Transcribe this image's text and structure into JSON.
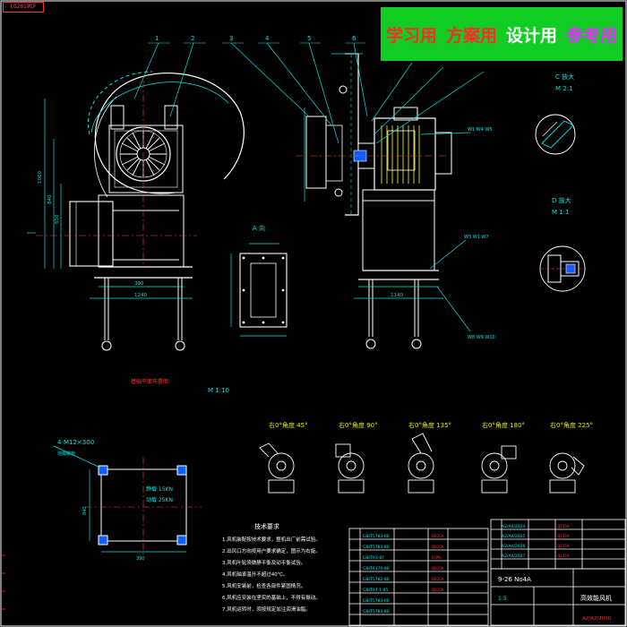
{
  "drawing": {
    "corner_code": "CG2019CF",
    "banner": {
      "items": [
        {
          "label": "学习用",
          "color": "#ff2a2a"
        },
        {
          "label": "方案用",
          "color": "#ff2a2a"
        },
        {
          "label": "设计用",
          "color": "#ffffff"
        },
        {
          "label": "参考用",
          "color": "#e033ff"
        }
      ]
    },
    "part_callouts": [
      "1",
      "2",
      "3",
      "4",
      "5",
      "6"
    ],
    "view_labels": {
      "section_a": "A 向",
      "detail_c": "C 放大",
      "detail_c_scale": "M 2:1",
      "detail_d": "D 放大",
      "detail_d_scale": "M 1:1",
      "foundation": "基础平面布置图",
      "foundation_scale": "M 1:10",
      "tech_requirements": "技术要求"
    },
    "dims": {
      "width_front": "390",
      "base_front": "1240",
      "side_length": "1140",
      "left_height_1": "1060",
      "left_height_2": "840",
      "left_height_3": "650",
      "foundation_width": "390",
      "foundation_height": "840",
      "bolt_spec": "4-M12×300",
      "bolt_note": "地脚螺栓",
      "load_1": "静载 15KN",
      "load_2": "动载 25KN"
    },
    "orientations": [
      {
        "label": "右0°角度 45°"
      },
      {
        "label": "右0°角度 90°"
      },
      {
        "label": "右0°角度 135°"
      },
      {
        "label": "右0°角度 180°"
      },
      {
        "label": "右0°角度 225°"
      }
    ],
    "weld_labels": [
      "W1 W4 W5",
      "W3 W1 W7",
      "W8 W9 W10"
    ],
    "notes": [
      "1.风机装配按技术要求，整机出厂前需试验。",
      "2.出风口方向按用户要求确定，图示为右旋。",
      "3.风机叶轮须做静平衡及动平衡试验。",
      "4.风机轴承温升不超过40℃。",
      "5.风机安装前，检查各部件紧固情况。",
      "6.风机应安装在坚实的基础上，不得有振动。",
      "7.风机运转时，须按规定加注润滑油脂。"
    ],
    "title_block": {
      "drawing_name": "高效能风机",
      "drawing_no": "A2/A2/2000",
      "model": "9-26 No4A",
      "scale": "1:5"
    }
  }
}
